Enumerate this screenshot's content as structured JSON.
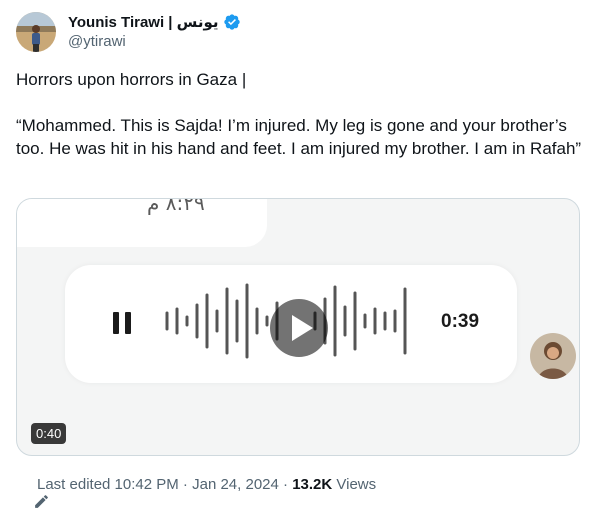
{
  "author": {
    "display_name": "Younis Tirawi | يونس",
    "handle": "@ytirawi",
    "verified_color": "#1d9bf0"
  },
  "tweet": {
    "line1": "Horrors upon horrors in Gaza |",
    "quote": "“Mohammed. This is Sajda! I’m injured. My leg is gone and your brother’s too. He was hit in his hand and feet. I am injured my brother. I am in Rafah”"
  },
  "media": {
    "chat_time": "٨:٢٩ م",
    "voice_duration": "0:39",
    "video_time": "0:40"
  },
  "footer": {
    "edited": "Last edited 10:42 PM",
    "sep1": " · ",
    "date": "Jan 24, 2024",
    "sep2": " · ",
    "views_count": "13.2K",
    "views_label": " Views"
  },
  "icons": {
    "verified": "verified-badge-icon",
    "pencil": "pencil-edit-icon",
    "play": "play-icon",
    "pause": "pause-icon"
  }
}
